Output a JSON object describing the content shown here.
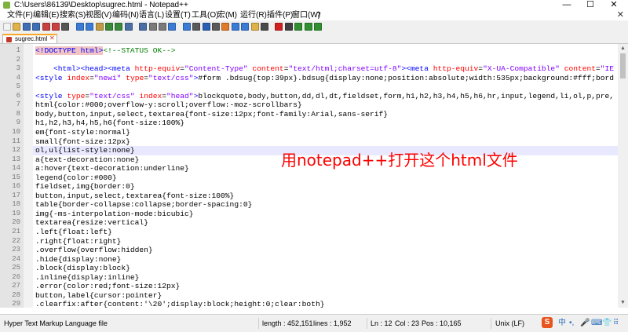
{
  "window": {
    "title": "C:\\Users\\86139\\Desktop\\sugrec.html - Notepad++",
    "minimize": "—",
    "maximize": "☐",
    "close": "✕"
  },
  "menu": {
    "items": [
      "文件(F)",
      "编辑(E)",
      "搜索(S)",
      "视图(V)",
      "编码(N)",
      "语言(L)",
      "设置(T)",
      "工具(O)",
      "宏(M)",
      "运行(R)",
      "插件(P)",
      "窗口(W)",
      "?"
    ],
    "close": "✕"
  },
  "toolbar": {
    "icons": [
      "new-file-icon",
      "open-file-icon",
      "save-icon",
      "save-all-icon",
      "close-icon",
      "close-all-icon",
      "print-icon",
      "cut-icon",
      "copy-icon",
      "paste-icon",
      "undo-icon",
      "redo-icon",
      "find-icon",
      "replace-icon",
      "zoom-in-icon",
      "zoom-out-icon",
      "sync-v-icon",
      "sync-h-icon",
      "wrap-icon",
      "all-chars-icon",
      "indent-guide-icon",
      "udl-icon",
      "doc-map-icon",
      "function-list-icon",
      "folder-workspace-icon",
      "monitor-icon",
      "record-icon",
      "stop-icon",
      "play-icon",
      "play-multi-icon",
      "save-macro-icon"
    ],
    "colors": [
      "#f3f3f3",
      "#e0b24a",
      "#3d6fb6",
      "#3d6fb6",
      "#c94040",
      "#c94040",
      "#555555",
      "#3a7bd5",
      "#3a7bd5",
      "#c29a45",
      "#3a8a3a",
      "#3a8a3a",
      "#4a6fa5",
      "#4a6fa5",
      "#7a7a7a",
      "#7a7a7a",
      "#3a7bd5",
      "#3a7bd5",
      "#5a5a5a",
      "#2b5fb4",
      "#5a5a5a",
      "#e07b2a",
      "#3a7bd5",
      "#3a7bd5",
      "#e0b24a",
      "#4a4a4a",
      "#d02020",
      "#404040",
      "#309030",
      "#309030",
      "#309030"
    ]
  },
  "tab": {
    "label": "sugrec.html",
    "close": "✕"
  },
  "editor": {
    "line_numbers": [
      "1",
      "2",
      "3",
      "4",
      "5",
      "6",
      "7",
      "8",
      "9",
      "10",
      "11",
      "12",
      "13",
      "14",
      "15",
      "16",
      "17",
      "18",
      "19",
      "20",
      "21",
      "22",
      "23",
      "24",
      "25",
      "26",
      "27",
      "28",
      "29"
    ],
    "current_line": 12,
    "lines": [
      [
        {
          "t": "tag hl",
          "v": "<!DOCTYPE html>"
        },
        {
          "t": "cmt",
          "v": "<!--STATUS OK-->"
        }
      ],
      [],
      [
        {
          "t": "",
          "v": "    "
        },
        {
          "t": "tag",
          "v": "<html><head><meta "
        },
        {
          "t": "attr",
          "v": "http-equiv"
        },
        {
          "t": "",
          "v": "="
        },
        {
          "t": "str",
          "v": "\"Content-Type\""
        },
        {
          "t": "",
          "v": " "
        },
        {
          "t": "attr",
          "v": "content"
        },
        {
          "t": "",
          "v": "="
        },
        {
          "t": "str",
          "v": "\"text/html;charset=utf-8\""
        },
        {
          "t": "tag",
          "v": "><meta "
        },
        {
          "t": "attr",
          "v": "http-equiv"
        },
        {
          "t": "",
          "v": "="
        },
        {
          "t": "str",
          "v": "\"X-UA-Compatible\""
        },
        {
          "t": "",
          "v": " "
        },
        {
          "t": "attr",
          "v": "content"
        },
        {
          "t": "",
          "v": "="
        },
        {
          "t": "str",
          "v": "\"IE"
        }
      ],
      [
        {
          "t": "tag",
          "v": "<style "
        },
        {
          "t": "attr",
          "v": "index"
        },
        {
          "t": "",
          "v": "="
        },
        {
          "t": "str",
          "v": "\"newi\""
        },
        {
          "t": "",
          "v": " "
        },
        {
          "t": "attr",
          "v": "type"
        },
        {
          "t": "",
          "v": "="
        },
        {
          "t": "str",
          "v": "\"text/css\""
        },
        {
          "t": "tag",
          "v": ">"
        },
        {
          "t": "",
          "v": "#form .bdsug{top:39px}.bdsug{display:none;position:absolute;width:535px;background:#fff;bord"
        }
      ],
      [],
      [
        {
          "t": "tag",
          "v": "<style "
        },
        {
          "t": "attr",
          "v": "type"
        },
        {
          "t": "",
          "v": "="
        },
        {
          "t": "str",
          "v": "\"text/css\""
        },
        {
          "t": "",
          "v": " "
        },
        {
          "t": "attr",
          "v": "index"
        },
        {
          "t": "",
          "v": "="
        },
        {
          "t": "str",
          "v": "\"head\""
        },
        {
          "t": "tag",
          "v": ">"
        },
        {
          "t": "",
          "v": "blockquote,body,button,dd,dl,dt,fieldset,form,h1,h2,h3,h4,h5,h6,hr,input,legend,li,ol,p,pre,"
        }
      ],
      [
        {
          "t": "",
          "v": "html{color:#000;overflow-y:scroll;overflow:-moz-scrollbars}"
        }
      ],
      [
        {
          "t": "",
          "v": "body,button,input,select,textarea{font-size:12px;font-family:Arial,sans-serif}"
        }
      ],
      [
        {
          "t": "",
          "v": "h1,h2,h3,h4,h5,h6{font-size:100%}"
        }
      ],
      [
        {
          "t": "",
          "v": "em{font-style:normal}"
        }
      ],
      [
        {
          "t": "",
          "v": "small{font-size:12px}"
        }
      ],
      [
        {
          "t": "",
          "v": "ol,ul{list-style:none}"
        }
      ],
      [
        {
          "t": "",
          "v": "a{text-decoration:none}"
        }
      ],
      [
        {
          "t": "",
          "v": "a:hover{text-decoration:underline}"
        }
      ],
      [
        {
          "t": "",
          "v": "legend{color:#000}"
        }
      ],
      [
        {
          "t": "",
          "v": "fieldset,img{border:0}"
        }
      ],
      [
        {
          "t": "",
          "v": "button,input,select,textarea{font-size:100%}"
        }
      ],
      [
        {
          "t": "",
          "v": "table{border-collapse:collapse;border-spacing:0}"
        }
      ],
      [
        {
          "t": "",
          "v": "img{-ms-interpolation-mode:bicubic}"
        }
      ],
      [
        {
          "t": "",
          "v": "textarea{resize:vertical}"
        }
      ],
      [
        {
          "t": "",
          "v": ".left{float:left}"
        }
      ],
      [
        {
          "t": "",
          "v": ".right{float:right}"
        }
      ],
      [
        {
          "t": "",
          "v": ".overflow{overflow:hidden}"
        }
      ],
      [
        {
          "t": "",
          "v": ".hide{display:none}"
        }
      ],
      [
        {
          "t": "",
          "v": ".block{display:block}"
        }
      ],
      [
        {
          "t": "",
          "v": ".inline{display:inline}"
        }
      ],
      [
        {
          "t": "",
          "v": ".error{color:red;font-size:12px}"
        }
      ],
      [
        {
          "t": "",
          "v": "button,label{cursor:pointer}"
        }
      ],
      [
        {
          "t": "",
          "v": ".clearfix:after{content:'\\20';display:block;height:0;clear:both}"
        }
      ]
    ]
  },
  "overlay": {
    "text": "用notepad++打开这个html文件",
    "color": "#ff0000"
  },
  "status": {
    "file_type": "Hyper Text Markup Language file",
    "length": "length : 452,151",
    "lines": "lines : 1,952",
    "ln": "Ln : 12",
    "col": "Col : 23",
    "pos": "Pos : 10,165",
    "eol": "Unix (LF)",
    "ime_logo": "S",
    "ime_items": [
      "中",
      "•,",
      "🎤",
      "⌨",
      "👕",
      "⠿"
    ]
  }
}
